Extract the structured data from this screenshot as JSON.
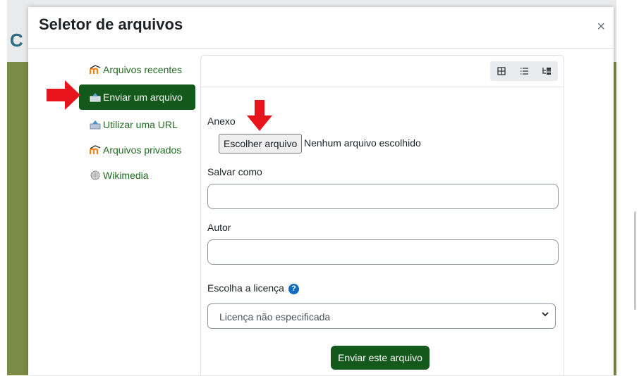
{
  "modal": {
    "title": "Seletor de arquivos",
    "close_label": "×"
  },
  "sidebar": {
    "items": [
      {
        "label": "Arquivos recentes",
        "icon": "moodle-icon",
        "active": false
      },
      {
        "label": "Enviar um arquivo",
        "icon": "upload-icon",
        "active": true
      },
      {
        "label": "Utilizar uma URL",
        "icon": "url-icon",
        "active": false
      },
      {
        "label": "Arquivos privados",
        "icon": "moodle-icon",
        "active": false
      },
      {
        "label": "Wikimedia",
        "icon": "wikimedia-icon",
        "active": false
      }
    ]
  },
  "toolbar": {
    "views": [
      "grid-view-icon",
      "list-view-icon",
      "tree-view-icon"
    ]
  },
  "form": {
    "attachment_label": "Anexo",
    "choose_file_label": "Escolher arquivo",
    "file_status": "Nenhum arquivo escolhido",
    "save_as_label": "Salvar como",
    "save_as_value": "",
    "author_label": "Autor",
    "author_value": "",
    "license_label": "Escolha a licença",
    "help_glyph": "?",
    "license_selected": "Licença não especificada",
    "submit_label": "Enviar este arquivo"
  },
  "colors": {
    "brand_green": "#13591b",
    "link_green": "#1f6a20",
    "annotation_red": "#e8141b"
  }
}
